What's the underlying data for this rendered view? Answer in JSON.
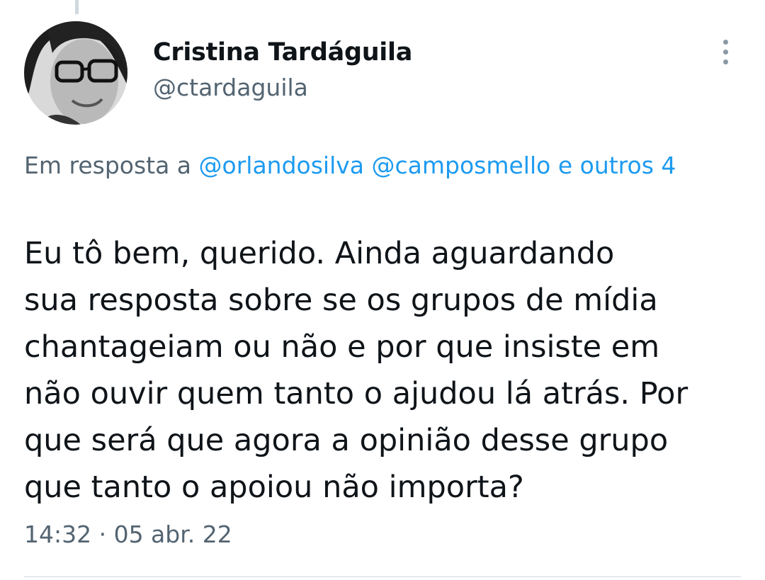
{
  "author": {
    "name": "Cristina Tardáguila",
    "handle": "@ctardaguila"
  },
  "reply": {
    "prefix": "Em resposta a",
    "mention_1": "@orlandosilva",
    "mention_2": "@camposmello",
    "others": "e outros 4"
  },
  "tweet": {
    "lines": [
      "Eu tô bem, querido. Ainda aguardando",
      "sua resposta sobre se os grupos de mídia",
      "chantageiam ou não e por que insiste em",
      "não ouvir quem tanto o ajudou lá atrás. Por",
      "que será que agora a opinião desse grupo",
      "que tanto o apoiou não importa?"
    ],
    "timestamp": "14:32 · 05 abr. 22"
  },
  "icons": {
    "more": "more-vertical-icon"
  },
  "colors": {
    "text": "#0f1419",
    "secondary": "#536471",
    "link": "#1d9bf0",
    "divider": "#cfd9de"
  }
}
